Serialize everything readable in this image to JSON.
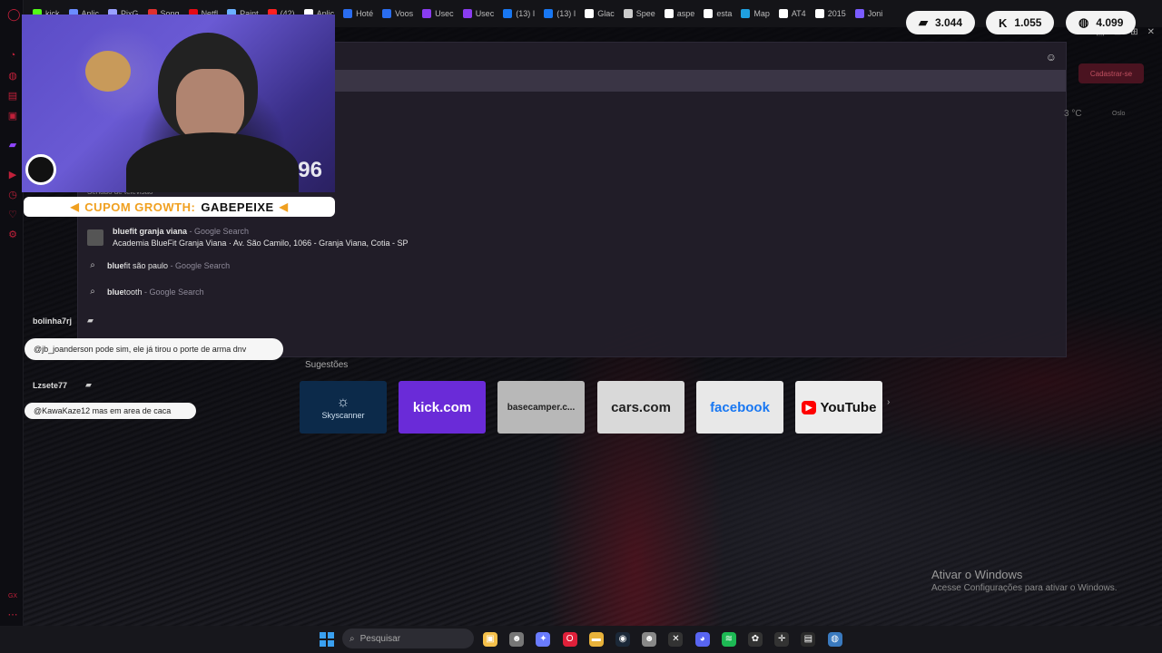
{
  "tabs": [
    {
      "label": "kick",
      "color": "#53fc18"
    },
    {
      "label": "Aplic",
      "color": "#6b8cff"
    },
    {
      "label": "PixG",
      "color": "#9aa0ff"
    },
    {
      "label": "Song",
      "color": "#e03030"
    },
    {
      "label": "Netfl",
      "color": "#e50914"
    },
    {
      "label": "Paint",
      "color": "#6bb0ff"
    },
    {
      "label": "(42)",
      "color": "#ff2020"
    },
    {
      "label": "Aplic",
      "color": "#ffffff"
    },
    {
      "label": "Hoté",
      "color": "#2a6df0"
    },
    {
      "label": "Voos",
      "color": "#2a6df0"
    },
    {
      "label": "Usec",
      "color": "#8a3cf0"
    },
    {
      "label": "Usec",
      "color": "#8a3cf0"
    },
    {
      "label": "(13) I",
      "color": "#1877f2"
    },
    {
      "label": "(13) I",
      "color": "#1877f2"
    },
    {
      "label": "Glac",
      "color": "#ffffff"
    },
    {
      "label": "Spee",
      "color": "#cccccc"
    },
    {
      "label": "aspe",
      "color": "#ffffff"
    },
    {
      "label": "esta",
      "color": "#ffffff"
    },
    {
      "label": "Map",
      "color": "#1fa0e0"
    },
    {
      "label": "AT4",
      "color": "#ffffff"
    },
    {
      "label": "2015",
      "color": "#ffffff"
    },
    {
      "label": "Joni",
      "color": "#7a5cff"
    }
  ],
  "window_controls": [
    "⬚",
    "⊟",
    "⊞",
    "✕"
  ],
  "stats": {
    "twitch": "3.044",
    "kick": "1.055",
    "total": "4.099"
  },
  "webcam": {
    "number": "96"
  },
  "coupon": {
    "prefix": "CUPOM GROWTH:",
    "code": "GABEPEIXE"
  },
  "search_suggestions": [
    {
      "bold": "bluefit granja viana",
      "suffix": " - Google Search",
      "detail": "Academia BlueFit Granja Viana · Av. São Camilo, 1066 - Granja Viana, Cotia - SP",
      "icon": "place"
    },
    {
      "bold": "blue",
      "rest": "fit são paulo",
      "suffix": " - Google Search",
      "icon": "search"
    },
    {
      "bold": "blue",
      "rest": "tooth",
      "suffix": " - Google Search",
      "icon": "search"
    }
  ],
  "partial_suggestion": "Senado de televisão",
  "right_panel": {
    "button": "Cadastrar-se",
    "temp": "3 °C",
    "city": "Oslo"
  },
  "chat": [
    {
      "user": "bolinha7rj",
      "message": "@jb_joanderson pode sim, ele já tirou o porte de arma dnv"
    },
    {
      "user": "Lzsete77",
      "message": "@KawaKaze12 mas em area de caca"
    }
  ],
  "speed_dial": {
    "heading": "Sugestões",
    "tiles": [
      {
        "label": "Skyscanner",
        "bg": "#0c2a4a",
        "fg": "#cfe0f0"
      },
      {
        "label": "kick.com",
        "bg": "#6a2bd8",
        "fg": "#ffffff"
      },
      {
        "label": "basecamper.c...",
        "bg": "#b8b8b8",
        "fg": "#222222"
      },
      {
        "label": "cars.com",
        "bg": "#d9d9d9",
        "fg": "#222222"
      },
      {
        "label": "facebook",
        "bg": "#e8e8e8",
        "fg": "#1877f2"
      },
      {
        "label": "YouTube",
        "bg": "#ececec",
        "fg": "#111111"
      }
    ]
  },
  "activate_windows": {
    "title": "Ativar o Windows",
    "subtitle": "Acesse Configurações para ativar o Windows."
  },
  "taskbar": {
    "search_placeholder": "Pesquisar",
    "apps": [
      {
        "name": "file-explorer-icon",
        "color": "#f5c04a",
        "glyph": "▣"
      },
      {
        "name": "notes-icon",
        "color": "#777777",
        "glyph": "☻"
      },
      {
        "name": "copilot-icon",
        "color": "#6a7cff",
        "glyph": "✦"
      },
      {
        "name": "opera-icon",
        "color": "#e0203a",
        "glyph": "O"
      },
      {
        "name": "folder-icon",
        "color": "#e8b23a",
        "glyph": "▬"
      },
      {
        "name": "steam-icon",
        "color": "#1b2838",
        "glyph": "◉"
      },
      {
        "name": "app-icon",
        "color": "#888888",
        "glyph": "☻"
      },
      {
        "name": "capcut-icon",
        "color": "#333333",
        "glyph": "✕"
      },
      {
        "name": "discord-icon",
        "color": "#5865f2",
        "glyph": "◕"
      },
      {
        "name": "spotify-icon",
        "color": "#1db954",
        "glyph": "≋"
      },
      {
        "name": "chatgpt-icon",
        "color": "#333333",
        "glyph": "✿"
      },
      {
        "name": "app2-icon",
        "color": "#333333",
        "glyph": "✛"
      },
      {
        "name": "terminal-icon",
        "color": "#2a2a2a",
        "glyph": "▤"
      },
      {
        "name": "globe-icon",
        "color": "#3a7abf",
        "glyph": "◍"
      }
    ]
  }
}
